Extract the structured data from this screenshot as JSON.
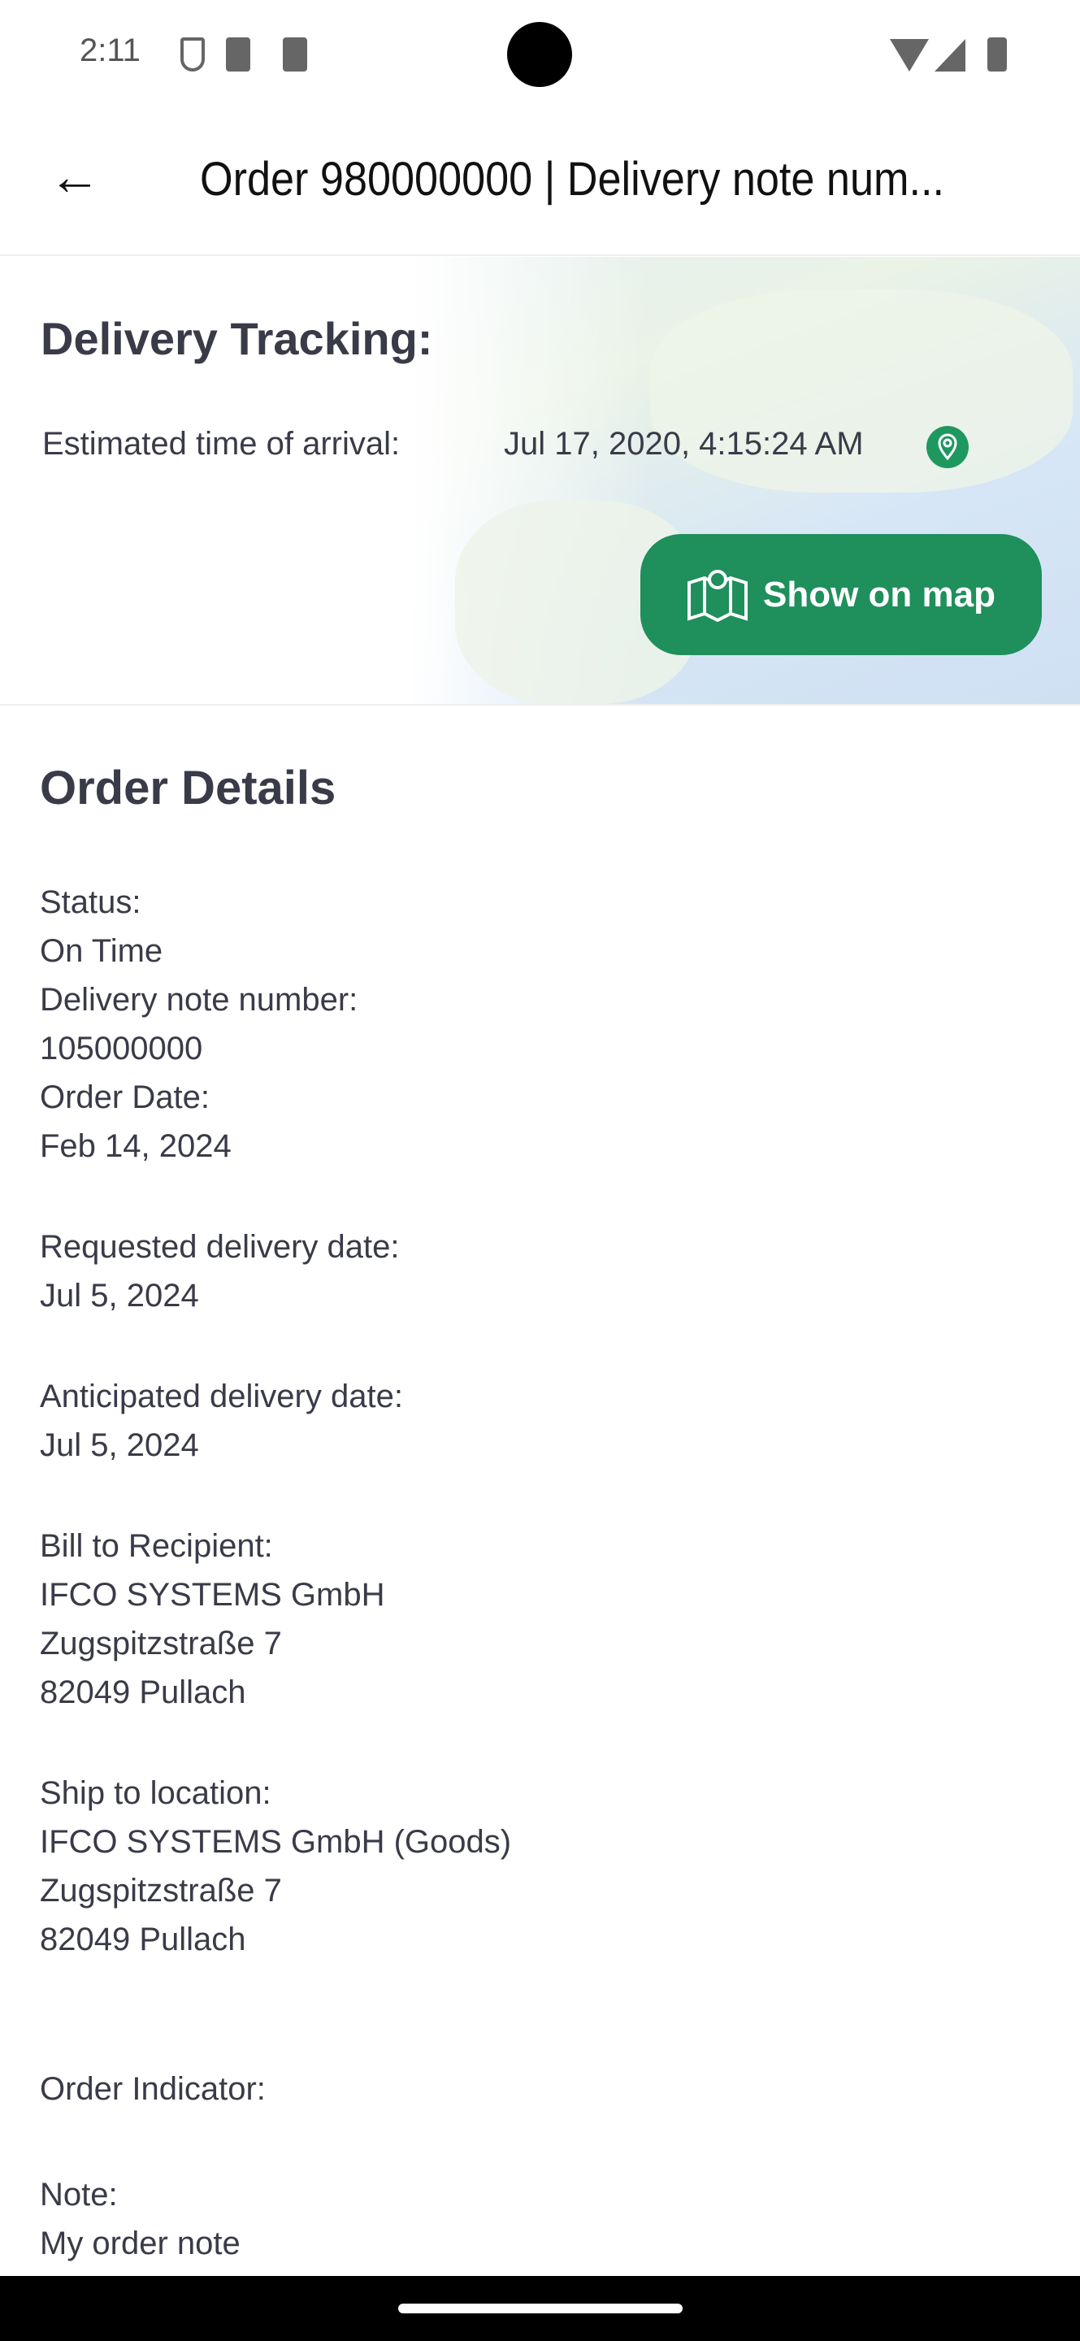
{
  "status_bar": {
    "time": "2:11"
  },
  "app_bar": {
    "title": "Order 980000000 | Delivery note num..."
  },
  "tracking": {
    "title": "Delivery Tracking:",
    "eta_label": "Estimated time of arrival:",
    "eta_value": "Jul 17, 2020, 4:15:24 AM",
    "show_on_map": "Show on map",
    "accent": "#1f8f5c"
  },
  "details": {
    "title": "Order Details",
    "status_label": "Status:",
    "status_value": "On Time",
    "delivery_note_label": "Delivery note number:",
    "delivery_note_value": "105000000",
    "order_date_label": "Order Date:",
    "order_date_value": "Feb 14, 2024",
    "requested_label": "Requested delivery date:",
    "requested_value": "Jul 5, 2024",
    "anticipated_label": "Anticipated delivery date:",
    "anticipated_value": "Jul 5, 2024",
    "bill_label": "Bill to Recipient:",
    "bill_lines": [
      "IFCO SYSTEMS GmbH",
      "Zugspitzstraße 7",
      "82049 Pullach"
    ],
    "ship_label": "Ship to location:",
    "ship_lines": [
      "IFCO SYSTEMS GmbH (Goods)",
      "Zugspitzstraße 7",
      "82049 Pullach"
    ],
    "indicator_label": "Order Indicator:",
    "note_label": "Note:",
    "note_value": "My order note"
  }
}
